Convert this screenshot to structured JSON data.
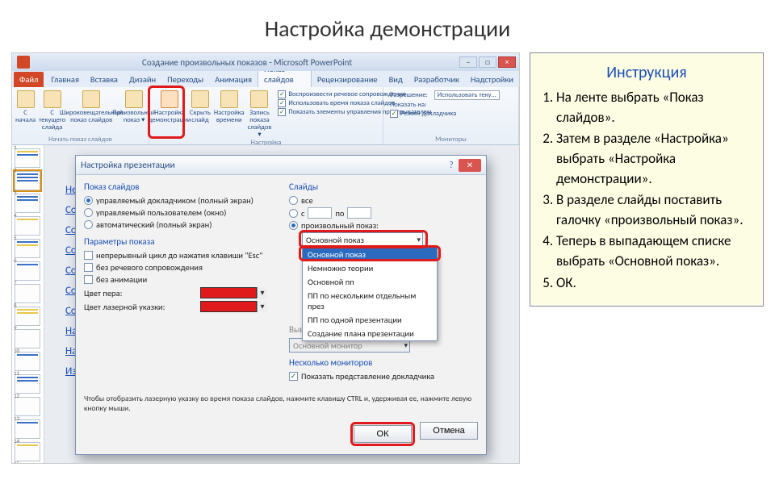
{
  "page_title": "Настройка демонстрации",
  "instruction": {
    "title": "Инструкция",
    "steps": [
      "На ленте выбрать «Показ слайдов».",
      "Затем в разделе «Настройка» выбрать «Настройка демонстрации».",
      "В разделе слайды поставить галочку «произвольный показ».",
      "Теперь в выпадающем списке выбрать «Основной показ».",
      "ОК."
    ]
  },
  "pp": {
    "title": "Создание произвольных показов - Microsoft PowerPoint",
    "tabs": {
      "file": "Файл",
      "list": [
        "Главная",
        "Вставка",
        "Дизайн",
        "Переходы",
        "Анимация",
        "Показ слайдов",
        "Рецензирование",
        "Вид",
        "Разработчик",
        "Надстройки"
      ],
      "active": "Показ слайдов"
    },
    "ribbon": {
      "group1": {
        "name": "Начать показ слайдов",
        "btns": [
          "С начала",
          "С текущего слайда",
          "Широковещательный показ слайдов",
          "Произвольный показ ▾"
        ]
      },
      "group2": {
        "name": "Настройка",
        "btn_setup": "Настройка демонстрации",
        "btn_hide": "Скрыть слайд",
        "btn_time": "Настройка времени",
        "btn_rec": "Запись показа слайдов ▾",
        "checks": [
          "Воспроизвести речевое сопровождение",
          "Использовать время показа слайдов",
          "Показать элементы управления проигрывателем"
        ]
      },
      "group3": {
        "name": "Мониторы",
        "res_label": "Разрешение:",
        "res_val": "Использовать теку...",
        "show_on": "Показать на:",
        "presenter": "Режим докладчика"
      }
    },
    "links": [
      "Не",
      "Со:",
      "Со:",
      "Со:",
      "Со:",
      "Со:",
      "Со:",
      "Нас",
      "Нас",
      "Изменение произвольного показа"
    ]
  },
  "dialog": {
    "title": "Настройка презентации",
    "sec_show": "Показ слайдов",
    "r_full": "управляемый докладчиком (полный экран)",
    "r_window": "управляемый пользователем (окно)",
    "r_auto": "автоматический (полный экран)",
    "sec_params": "Параметры показа",
    "c_loop": "непрерывный цикл до нажатия клавиши \"Esc\"",
    "c_nonarr": "без речевого сопровождения",
    "c_noanim": "без анимации",
    "pen_label": "Цвет пера:",
    "laser_label": "Цвет лазерной указки:",
    "hint": "Чтобы отобразить лазерную указку во время показа слайдов, нажмите клавишу CTRL и, удерживая ее, нажмите левую кнопку мыши.",
    "sec_slides": "Слайды",
    "r_all": "все",
    "r_from": "с",
    "r_to": "по",
    "r_custom": "произвольный показ:",
    "dd_selected": "Основной показ",
    "dd_options": [
      "Основной показ",
      "Немножко теории",
      "Основной пп",
      "ПП по нескольким отдельным през",
      "ПП по одной презентации",
      "Создание плана презентации"
    ],
    "sec_advance": "Выводить слайды на:",
    "monitor": "Основной монитор",
    "sec_multi": "Несколько мониторов",
    "c_presenter": "Показать представление докладчика",
    "ok": "ОК",
    "cancel": "Отмена"
  }
}
